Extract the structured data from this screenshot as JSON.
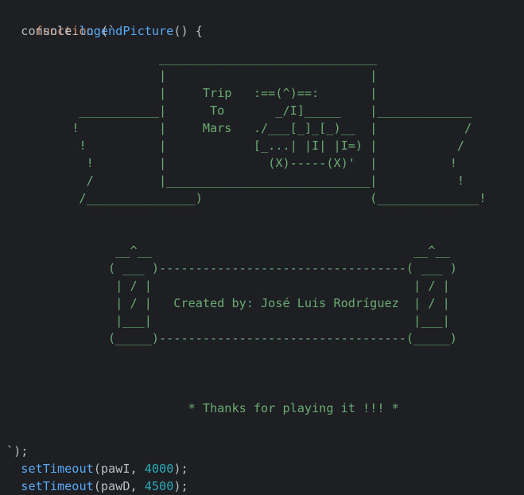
{
  "code": {
    "line1": {
      "keyword": "function",
      "name": "endPicture",
      "rest": "() {"
    },
    "line2": {
      "object": "console",
      "dot": ".",
      "method": "log",
      "open": "(`"
    },
    "art_lines": [
      "                     ______________________________",
      "                     |                            |",
      "                     |     Trip   :==(^)==:       |",
      "          ___________|      To       _/I]_____    |_____________",
      "         !           |     Mars   ./___[_]_[_)__  |            /",
      "          !          |            [_...| |I| |I=) |           /",
      "           !         |              (X)-----(X)'  |          !",
      "           /         |____________________________|           !",
      "          /_______________)                       (______________!",
      "",
      "",
      "               __^__                                    __^__",
      "              ( ___ )----------------------------------( ___ )",
      "               | / |                                    | / |",
      "               | / |   Created by: José Luis Rodríguez  | / |",
      "               |___|                                    |___|",
      "              (_____)----------------------------------(_____)",
      "",
      "",
      "",
      "                         * Thanks for playing it !!! *"
    ],
    "close_line": "`);",
    "calls": [
      {
        "name": "setTimeout",
        "arg": "pawI",
        "delay": "4000"
      },
      {
        "name": "setTimeout",
        "arg": "pawD",
        "delay": "4500"
      }
    ]
  }
}
